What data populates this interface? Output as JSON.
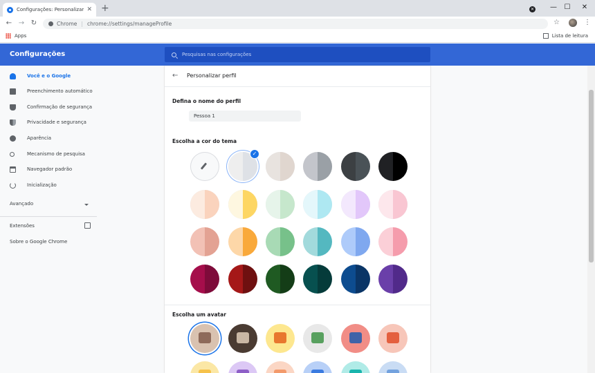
{
  "browser": {
    "tab_title": "Configurações: Personalizar perfil",
    "tab_close": "✕",
    "new_tab": "+",
    "controls": {
      "minimize": "—",
      "maximize": "☐",
      "close": "✕"
    },
    "nav": {
      "back": "←",
      "forward": "→",
      "reload": "↻"
    },
    "omnibox": {
      "scheme": "Chrome",
      "url": "chrome://settings/manageProfile"
    },
    "star": "☆",
    "menu": "⋮",
    "bookmarks": {
      "apps": "Apps",
      "reading_list": "Lista de leitura"
    }
  },
  "header": {
    "title": "Configurações",
    "search_placeholder": "Pesquisas nas configurações"
  },
  "sidebar": {
    "items": [
      {
        "label": "Você e o Google",
        "icon": "person-icon"
      },
      {
        "label": "Preenchimento automático",
        "icon": "clipboard-icon"
      },
      {
        "label": "Confirmação de segurança",
        "icon": "shield-icon"
      },
      {
        "label": "Privacidade e segurança",
        "icon": "privacy-shield-icon"
      },
      {
        "label": "Aparência",
        "icon": "palette-icon"
      },
      {
        "label": "Mecanismo de pesquisa",
        "icon": "search-icon"
      },
      {
        "label": "Navegador padrão",
        "icon": "browser-icon"
      },
      {
        "label": "Inicialização",
        "icon": "power-icon"
      }
    ],
    "advanced": "Avançado",
    "extensions": "Extensões",
    "about": "Sobre o Google Chrome"
  },
  "main": {
    "back": "←",
    "title": "Personalizar perfil",
    "name_label": "Defina o nome do perfil",
    "name_value": "Pessoa 1",
    "theme_label": "Escolha a cor do tema",
    "avatar_label": "Escolha um avatar",
    "check": "✓"
  },
  "colors": {
    "accent": "#1a73e8",
    "header": "#3367d6",
    "theme_swatches": [
      [
        "picker",
        [
          "#eeeeee",
          "#dee1e6"
        ],
        [
          "#e8e3df",
          "#e0d6cf"
        ],
        [
          "#c3c5cb",
          "#9aa0a6"
        ],
        [
          "#3c4043",
          "#4a5257"
        ],
        [
          "#202124",
          "#000000"
        ]
      ],
      [
        [
          "#fcebe0",
          "#fad3bd"
        ],
        [
          "#fef7e0",
          "#fdd663"
        ],
        [
          "#e6f4ea",
          "#c6e7cc"
        ],
        [
          "#e4f7fb",
          "#aee8f2"
        ],
        [
          "#f3e8fd",
          "#e2c7fa"
        ],
        [
          "#fde7ec",
          "#f9c6d2"
        ]
      ],
      [
        [
          "#f2c1b5",
          "#e3a293"
        ],
        [
          "#fdd7a8",
          "#f9a93b"
        ],
        [
          "#a8dab5",
          "#77c18a"
        ],
        [
          "#a2dadc",
          "#54b8c0"
        ],
        [
          "#aecbfa",
          "#7fa8ef"
        ],
        [
          "#fbcfd7",
          "#f59cac"
        ]
      ],
      [
        [
          "#a50e4b",
          "#7e0b3a"
        ],
        [
          "#a51818",
          "#6f1010"
        ],
        [
          "#1f5a22",
          "#143d17"
        ],
        [
          "#07504f",
          "#053b3a"
        ],
        [
          "#0d4c8f",
          "#0a3566"
        ],
        [
          "#6a3fa9",
          "#512a8a"
        ]
      ]
    ],
    "avatar_art": [
      [
        "#8e6a5a",
        "#d9c2b0"
      ],
      [
        "#c9b7a4",
        "#4a3b32"
      ],
      [
        "#e8772e",
        "#fde78f"
      ],
      [
        "#58a05f",
        "#e8e8e8"
      ],
      [
        "#3f63a8",
        "#f18d86"
      ],
      [
        "#e4603f",
        "#f7c6b9"
      ],
      [
        "#f6c24b",
        "#fbe7a5"
      ],
      [
        "#8e5fc7",
        "#dcc8f5"
      ],
      [
        "#f39a6b",
        "#fbd6c4"
      ],
      [
        "#3b7be0",
        "#b8d0f7"
      ],
      [
        "#1ab5ad",
        "#b0ebe7"
      ],
      [
        "#73a2de",
        "#c9dcf4"
      ]
    ]
  }
}
